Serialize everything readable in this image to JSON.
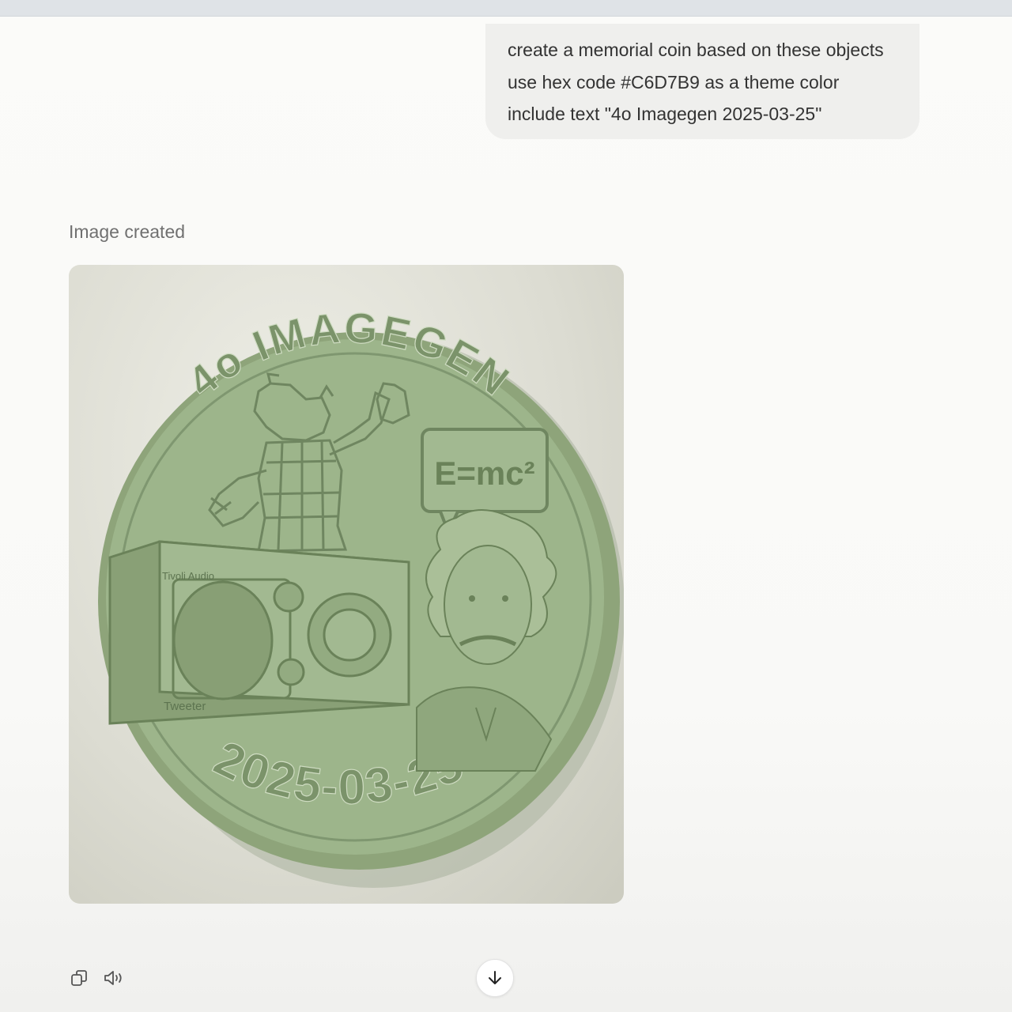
{
  "user_message": {
    "lines": [
      "create a memorial coin based on these objects",
      "use hex code #C6D7B9 as a theme color",
      "include text \"4o Imagegen 2025-03-25\""
    ]
  },
  "assistant": {
    "status": "Image created",
    "image": {
      "coin_top_text": "4o IMAGEGEN",
      "coin_bottom_text": "2025-03-25",
      "speech_bubble": "E=mc²",
      "radio_brand": "Tivoli Audio",
      "radio_model": "Tweeter",
      "theme_color": "#C6D7B9"
    }
  },
  "actions": {
    "copy_icon": "copy-icon",
    "speaker_icon": "speaker-icon",
    "scroll_icon": "arrow-down-icon"
  }
}
